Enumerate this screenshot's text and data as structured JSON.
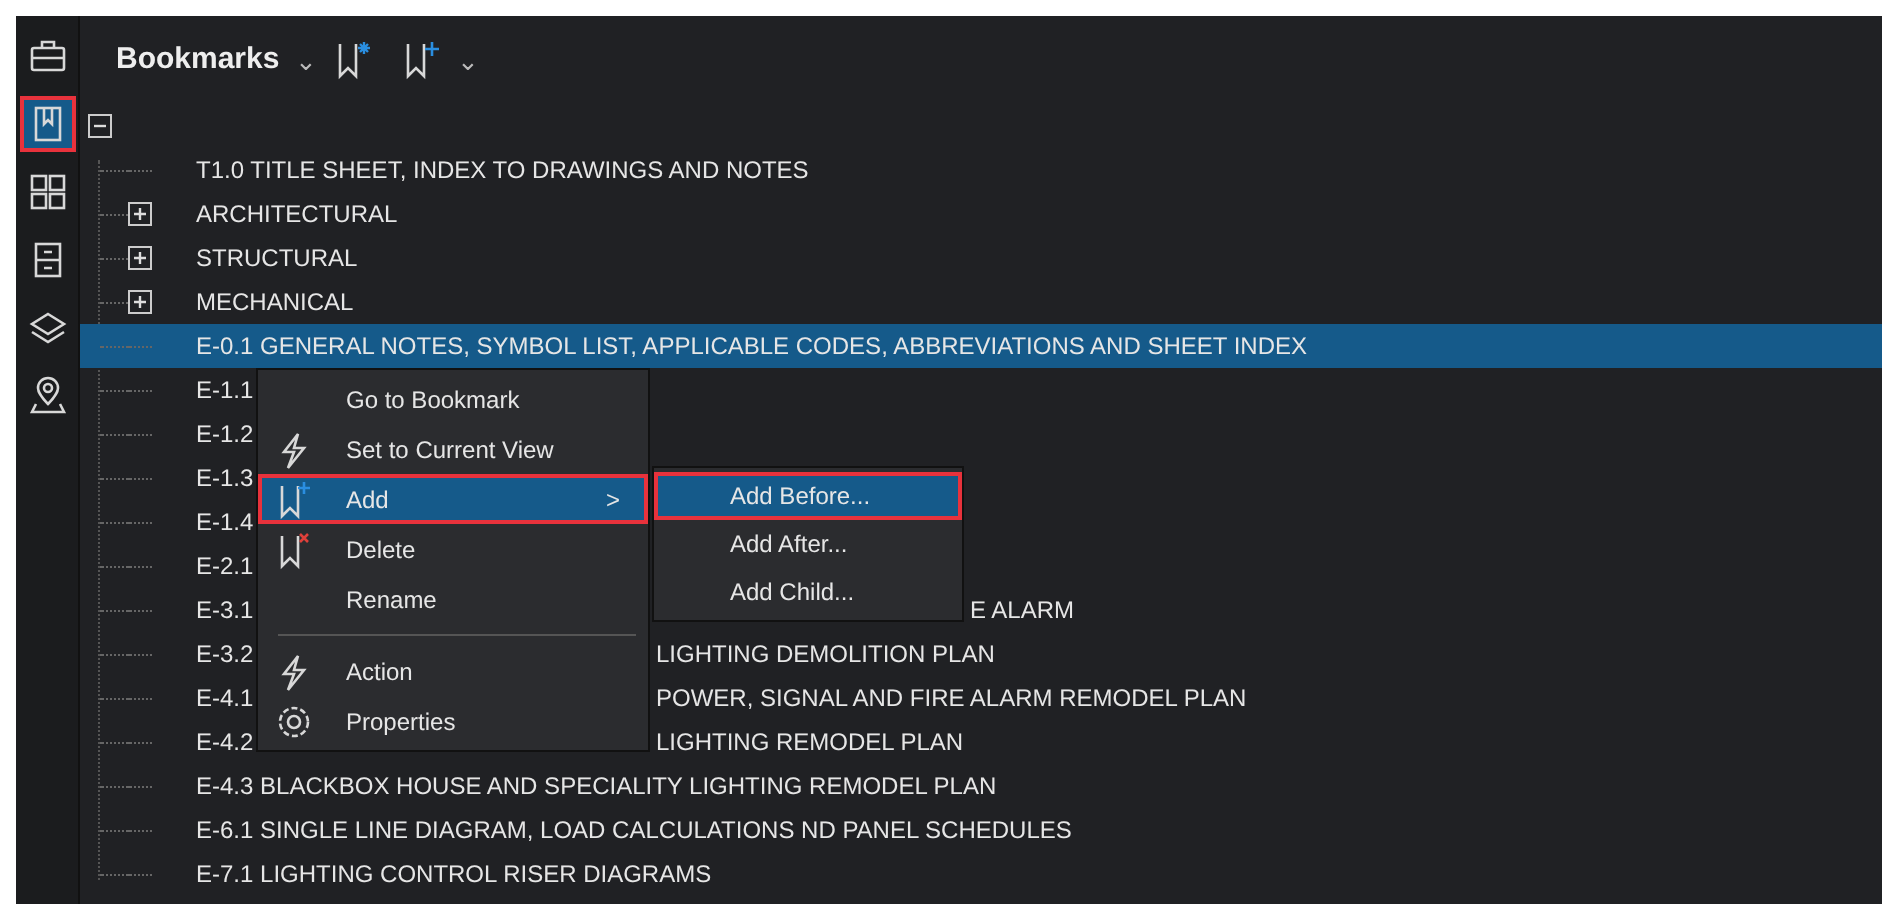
{
  "sidebar": {
    "items": [
      {
        "kind": "briefcase",
        "selected": false
      },
      {
        "kind": "bookmark",
        "selected": true
      },
      {
        "kind": "grid",
        "selected": false
      },
      {
        "kind": "cabinet",
        "selected": false
      },
      {
        "kind": "layers",
        "selected": false
      },
      {
        "kind": "pin",
        "selected": false
      }
    ]
  },
  "header": {
    "title": "Bookmarks",
    "chevron": "⌄"
  },
  "tree": {
    "root": {
      "expanded": true,
      "children": [
        {
          "label": "T1.0 TITLE SHEET, INDEX TO DRAWINGS AND NOTES",
          "selected": false
        },
        {
          "label": "ARCHITECTURAL",
          "expanded": false,
          "selected": false
        },
        {
          "label": "STRUCTURAL",
          "expanded": false,
          "selected": false
        },
        {
          "label": "MECHANICAL",
          "expanded": false,
          "selected": false
        },
        {
          "label": "E-0.1 GENERAL NOTES, SYMBOL LIST, APPLICABLE CODES, ABBREVIATIONS AND SHEET INDEX",
          "selected": true
        },
        {
          "label": "E-1.1",
          "selected": false
        },
        {
          "label": "E-1.2",
          "selected": false
        },
        {
          "label": "E-1.3",
          "selected": false
        },
        {
          "label": "E-1.4",
          "selected": false
        },
        {
          "label": "E-2.1",
          "selected": false
        },
        {
          "label": "E-3.1",
          "selected": false,
          "tail": "E ALARM"
        },
        {
          "label": "E-3.2",
          "selected": false,
          "tail": "LIGHTING DEMOLITION PLAN"
        },
        {
          "label": "E-4.1",
          "selected": false,
          "tail": "POWER, SIGNAL AND FIRE ALARM REMODEL PLAN"
        },
        {
          "label": "E-4.2",
          "selected": false,
          "tail": "LIGHTING REMODEL PLAN"
        },
        {
          "label": "E-4.3 BLACKBOX HOUSE AND SPECIALITY LIGHTING REMODEL PLAN",
          "selected": false
        },
        {
          "label": "E-6.1 SINGLE LINE DIAGRAM, LOAD CALCULATIONS ND  PANEL SCHEDULES",
          "selected": false
        },
        {
          "label": "E-7.1 LIGHTING CONTROL RISER DIAGRAMS",
          "selected": false
        }
      ]
    }
  },
  "context_menu": {
    "items": [
      {
        "kind": "plain",
        "label": "Go to Bookmark",
        "selected": false
      },
      {
        "kind": "bolt",
        "label": "Set to Current View",
        "selected": false
      },
      {
        "kind": "add",
        "label": "Add",
        "submenu": true,
        "arrow": ">",
        "selected": true
      },
      {
        "kind": "delete",
        "label": "Delete",
        "selected": false
      },
      {
        "kind": "plain",
        "label": "Rename",
        "selected": false
      },
      {
        "kind": "separator"
      },
      {
        "kind": "bolt",
        "label": "Action",
        "selected": false
      },
      {
        "kind": "settings",
        "label": "Properties",
        "selected": false
      }
    ]
  },
  "submenu": {
    "items": [
      {
        "label": "Add Before...",
        "selected": true
      },
      {
        "label": "Add After...",
        "selected": false
      },
      {
        "label": "Add Child...",
        "selected": false
      }
    ]
  }
}
